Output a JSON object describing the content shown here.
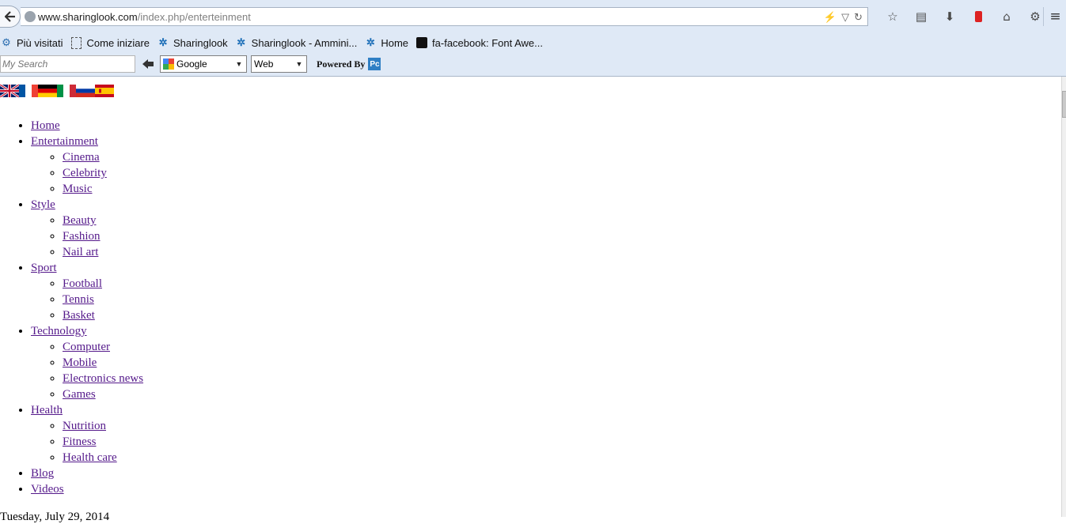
{
  "browser": {
    "url_host": "www.sharinglook.com",
    "url_path": "/index.php/enterteinment",
    "bookmarks": [
      {
        "label": "Più visitati",
        "icon": "most-visited-icon"
      },
      {
        "label": "Come iniziare",
        "icon": "page-icon"
      },
      {
        "label": "Sharinglook",
        "icon": "joomla-icon"
      },
      {
        "label": "Sharinglook - Ammini...",
        "icon": "joomla-icon"
      },
      {
        "label": "Home",
        "icon": "joomla-icon"
      },
      {
        "label": "fa-facebook: Font Awe...",
        "icon": "flag-icon"
      }
    ],
    "search_toolbar": {
      "placeholder": "My Search",
      "engine": "Google",
      "scope": "Web",
      "powered_by": "Powered By",
      "powered_logo": "Pc"
    }
  },
  "page": {
    "languages": [
      {
        "code": "en",
        "colors": [
          "#012169",
          "#ffffff",
          "#c8102e"
        ]
      },
      {
        "code": "fr",
        "colors": [
          "#0055a4",
          "#ffffff",
          "#ef4135"
        ]
      },
      {
        "code": "de",
        "colors": [
          "#000000",
          "#dd0000",
          "#ffce00"
        ]
      },
      {
        "code": "it",
        "colors": [
          "#009246",
          "#ffffff",
          "#ce2b37"
        ]
      },
      {
        "code": "ru",
        "colors": [
          "#ffffff",
          "#0039a6",
          "#d52b1e"
        ]
      },
      {
        "code": "es",
        "colors": [
          "#c60b1e",
          "#ffc400",
          "#c60b1e"
        ]
      }
    ],
    "menu": [
      {
        "label": "Home",
        "children": []
      },
      {
        "label": "Entertainment",
        "children": [
          "Cinema",
          "Celebrity",
          "Music"
        ]
      },
      {
        "label": "Style",
        "children": [
          "Beauty",
          "Fashion",
          "Nail art"
        ]
      },
      {
        "label": "Sport",
        "children": [
          "Football",
          "Tennis",
          "Basket"
        ]
      },
      {
        "label": "Technology",
        "children": [
          "Computer",
          "Mobile",
          "Electronics news",
          "Games"
        ]
      },
      {
        "label": "Health",
        "children": [
          "Nutrition",
          "Fitness",
          "Health care"
        ]
      },
      {
        "label": "Blog",
        "children": []
      },
      {
        "label": "Videos",
        "children": []
      }
    ],
    "date": "Tuesday, July 29, 2014"
  },
  "colors": {
    "link_visited": "#551a8b",
    "chrome_bg": "#dfe9f6"
  }
}
